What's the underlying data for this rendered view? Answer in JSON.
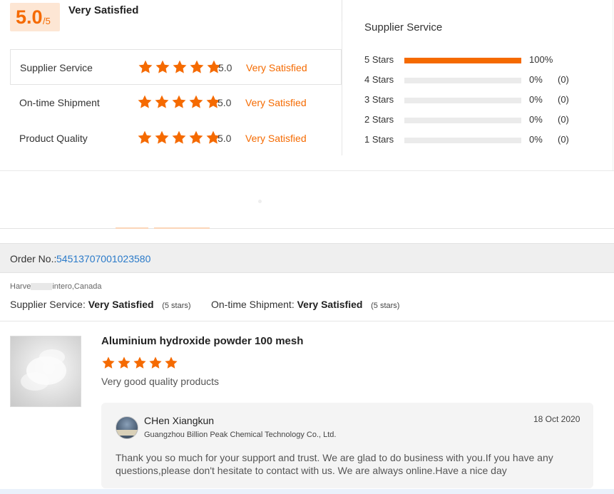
{
  "summary": {
    "score": "5.0",
    "score_max": "/5",
    "overall_label": "Very Satisfied",
    "ratings": [
      {
        "label": "Supplier Service",
        "stars": 5,
        "score": "5.0",
        "verdict": "Very Satisfied"
      },
      {
        "label": "On-time Shipment",
        "stars": 5,
        "score": "5.0",
        "verdict": "Very Satisfied"
      },
      {
        "label": "Product Quality",
        "stars": 5,
        "score": "5.0",
        "verdict": "Very Satisfied"
      }
    ],
    "distribution_title": "Supplier Service",
    "distribution": [
      {
        "label": "5  Stars",
        "fraction": 1.0,
        "pct": "100%",
        "count": ""
      },
      {
        "label": "4  Stars",
        "fraction": 0.0,
        "pct": "0%",
        "count": "(0)"
      },
      {
        "label": "3  Stars",
        "fraction": 0.0,
        "pct": "0%",
        "count": "(0)"
      },
      {
        "label": "2  Stars",
        "fraction": 0.0,
        "pct": "0%",
        "count": "(0)"
      },
      {
        "label": "1  Stars",
        "fraction": 0.0,
        "pct": "0%",
        "count": "(0)"
      }
    ]
  },
  "order": {
    "label": "Order No.: ",
    "number": "54513707001023580",
    "buyer_prefix": "Harve",
    "buyer_suffix": "intero,Canada",
    "supplier_service_label": "Supplier Service: ",
    "supplier_service_value": "Very Satisfied",
    "supplier_service_stars": "(5 stars)",
    "shipment_label": "On-time Shipment: ",
    "shipment_value": "Very Satisfied",
    "shipment_stars": "(5 stars)"
  },
  "review": {
    "product_title": "Aluminium hydroxide powder 100 mesh",
    "stars": 5,
    "comment": "Very good quality products",
    "reply": {
      "name": "CHen Xiangkun",
      "company": "Guangzhou Billion Peak Chemical Technology Co., Ltd.",
      "date": "18 Oct 2020",
      "text": "Thank you so much for your support and trust. We are glad to do business with you.If you have any questions,please don't hesitate to contact with us. We are always online.Have a nice day"
    }
  },
  "colors": {
    "accent": "#f56a00",
    "badge_bg": "#fde6d4",
    "link": "#2a7ac9"
  },
  "icons": {
    "star": "star-icon"
  }
}
